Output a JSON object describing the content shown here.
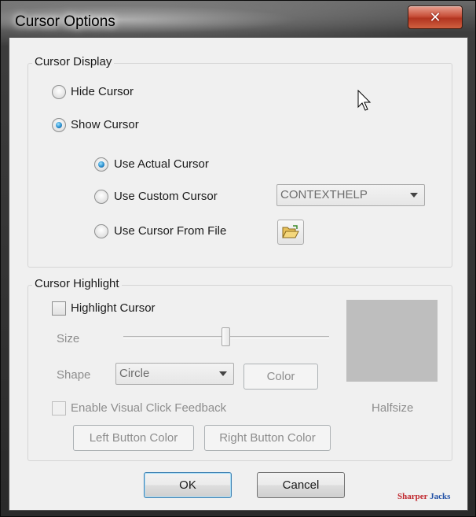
{
  "window": {
    "title": "Cursor Options",
    "close_glyph": "✕"
  },
  "cursor_display": {
    "group_title": "Cursor Display",
    "hide_cursor": {
      "label": "Hide Cursor",
      "checked": false
    },
    "show_cursor": {
      "label": "Show Cursor",
      "checked": true
    },
    "use_actual": {
      "label": "Use Actual Cursor",
      "checked": true
    },
    "use_custom": {
      "label": "Use Custom Cursor",
      "checked": false,
      "select_value": "CONTEXTHELP"
    },
    "use_file": {
      "label": "Use Cursor From File",
      "checked": false,
      "icon": "open-folder-icon"
    }
  },
  "cursor_highlight": {
    "group_title": "Cursor Highlight",
    "highlight_cursor": {
      "label": "Highlight Cursor",
      "checked": false
    },
    "size_label": "Size",
    "size_level": 0.5,
    "shape_label": "Shape",
    "shape_value": "Circle",
    "color_button": "Color",
    "preview_color": "#bebebe",
    "preview_caption": "Halfsize",
    "click_feedback": {
      "label": "Enable Visual Click Feedback",
      "checked": false
    },
    "left_button_color": "Left Button Color",
    "right_button_color": "Right Button Color"
  },
  "footer": {
    "ok": "OK",
    "cancel": "Cancel"
  },
  "watermark": {
    "part1": "Sharper",
    "part2": "Jacks"
  },
  "colors": {
    "radio_selected": "#2a8fce",
    "disabled_text": "#8d8d8d"
  }
}
